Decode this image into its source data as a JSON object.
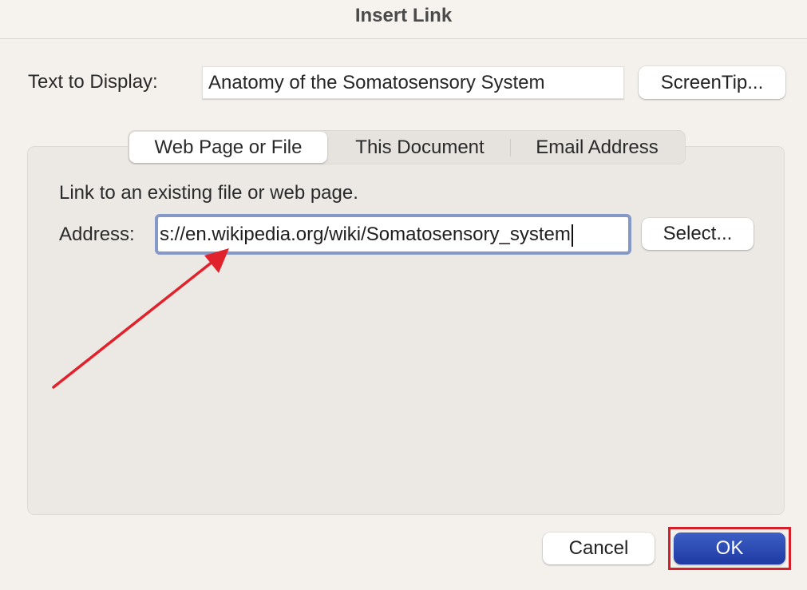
{
  "dialog": {
    "title": "Insert Link",
    "text_to_display_label": "Text to Display:",
    "text_to_display_value": "Anatomy of the Somatosensory System",
    "screentip_button": "ScreenTip...",
    "tabs": [
      {
        "label": "Web Page or File",
        "active": true
      },
      {
        "label": "This Document",
        "active": false
      },
      {
        "label": "Email Address",
        "active": false
      }
    ],
    "instruction": "Link to an existing file or web page.",
    "address_label": "Address:",
    "address_value": "s://en.wikipedia.org/wiki/Somatosensory_system",
    "select_button": "Select...",
    "cancel_button": "Cancel",
    "ok_button": "OK"
  },
  "annotations": {
    "arrow_color": "#e0222c",
    "highlight_color": "#d5202a"
  }
}
